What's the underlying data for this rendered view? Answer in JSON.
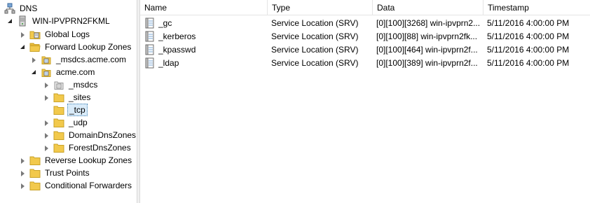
{
  "tree": {
    "root": "DNS",
    "server": "WIN-IPVPRN2FKML",
    "items": [
      {
        "label": "Global Logs"
      },
      {
        "label": "Forward Lookup Zones"
      },
      {
        "label": "_msdcs.acme.com"
      },
      {
        "label": "acme.com"
      },
      {
        "label": "_msdcs"
      },
      {
        "label": "_sites"
      },
      {
        "label": "_tcp"
      },
      {
        "label": "_udp"
      },
      {
        "label": "DomainDnsZones"
      },
      {
        "label": "ForestDnsZones"
      },
      {
        "label": "Reverse Lookup Zones"
      },
      {
        "label": "Trust Points"
      },
      {
        "label": "Conditional Forwarders"
      }
    ]
  },
  "list": {
    "columns": [
      "Name",
      "Type",
      "Data",
      "Timestamp"
    ],
    "rows": [
      {
        "name": "_gc",
        "type": "Service Location (SRV)",
        "data": "[0][100][3268] win-ipvprn2...",
        "timestamp": "5/11/2016 4:00:00 PM"
      },
      {
        "name": "_kerberos",
        "type": "Service Location (SRV)",
        "data": "[0][100][88] win-ipvprn2fk...",
        "timestamp": "5/11/2016 4:00:00 PM"
      },
      {
        "name": "_kpasswd",
        "type": "Service Location (SRV)",
        "data": "[0][100][464] win-ipvprn2f...",
        "timestamp": "5/11/2016 4:00:00 PM"
      },
      {
        "name": "_ldap",
        "type": "Service Location (SRV)",
        "data": "[0][100][389] win-ipvprn2f...",
        "timestamp": "5/11/2016 4:00:00 PM"
      }
    ]
  },
  "colors": {
    "folder": "#f2c94c",
    "selection_bg": "#d9ebf9",
    "selection_border": "#3c7fb1"
  }
}
